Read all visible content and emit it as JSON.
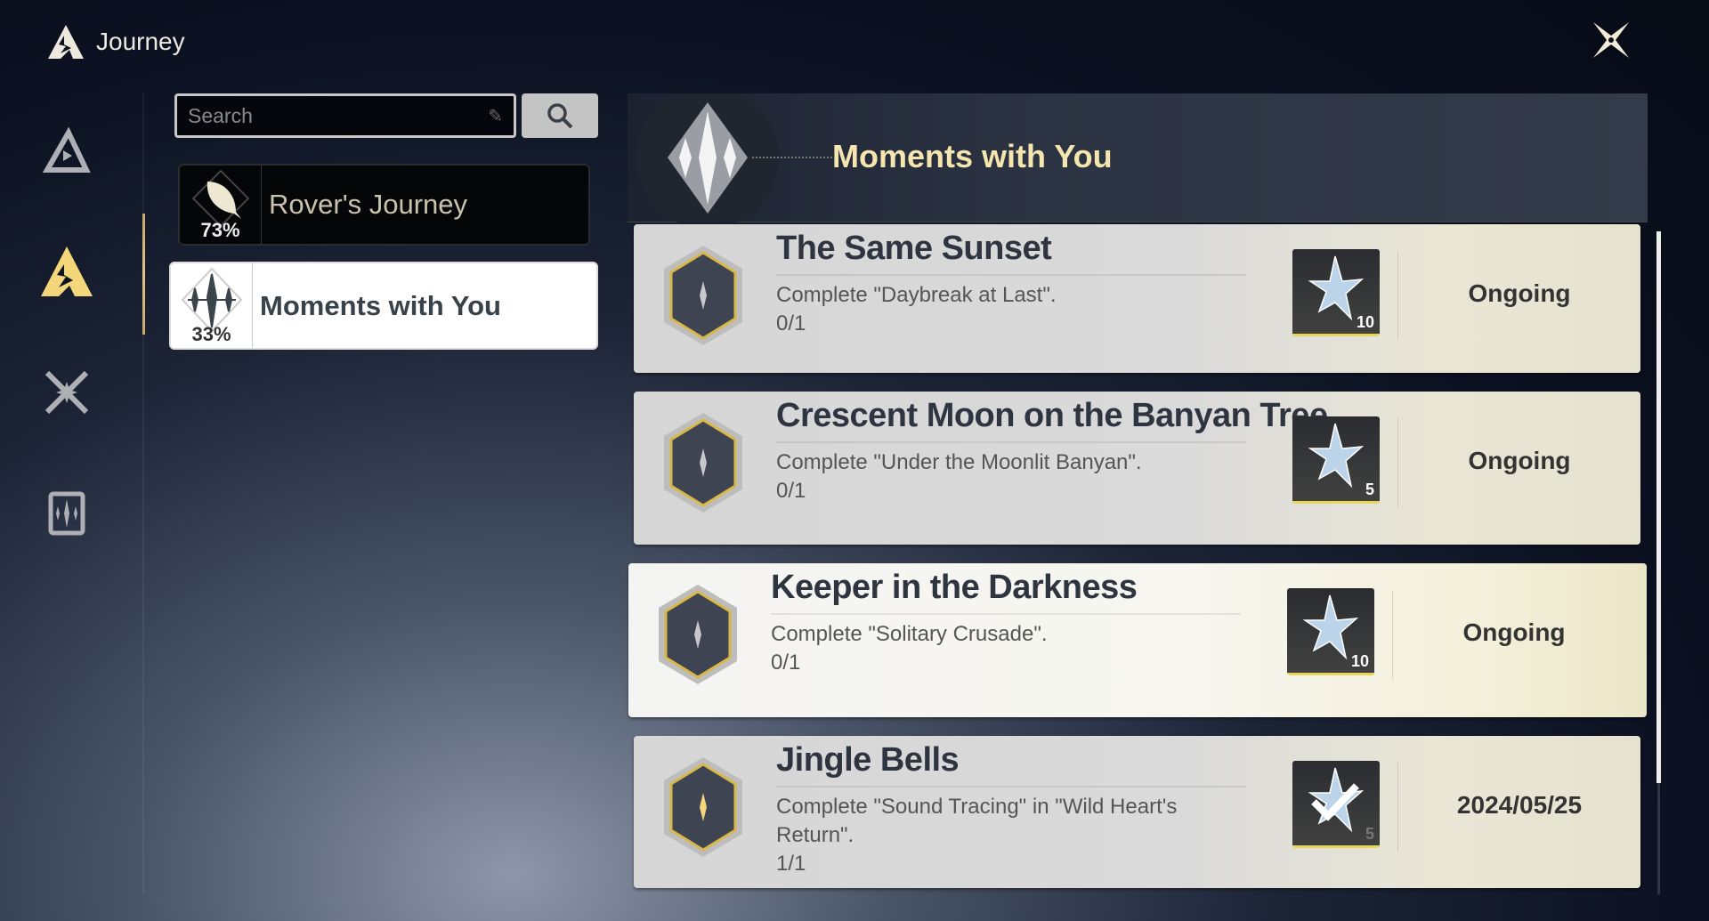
{
  "header": {
    "title": "Journey",
    "close_icon": "close-x-icon"
  },
  "nav": {
    "items": [
      {
        "icon": "triangle-play-icon"
      },
      {
        "icon": "journey-mountain-icon",
        "active": true
      },
      {
        "icon": "crossed-swords-icon"
      },
      {
        "icon": "card-sparkle-icon"
      }
    ]
  },
  "search": {
    "placeholder": "Search",
    "value": ""
  },
  "categories": [
    {
      "label": "Rover's Journey",
      "progress": "73%",
      "icon": "feather-icon"
    },
    {
      "label": "Moments with You",
      "progress": "33%",
      "icon": "sparkles-icon",
      "selected": true
    }
  ],
  "banner": {
    "title": "Moments with You"
  },
  "achievements": [
    {
      "title": "The Same Sunset",
      "desc": "Complete \"Daybreak at Last\".",
      "progress": "0/1",
      "reward": "10",
      "status": "Ongoing"
    },
    {
      "title": "Crescent Moon on the Banyan Tree",
      "desc": "Complete \"Under the Moonlit Banyan\".",
      "progress": "0/1",
      "reward": "5",
      "status": "Ongoing"
    },
    {
      "title": "Keeper in the Darkness",
      "desc": "Complete \"Solitary Crusade\".",
      "progress": "0/1",
      "reward": "10",
      "status": "Ongoing"
    },
    {
      "title": "Jingle Bells",
      "desc": "Complete \"Sound Tracing\" in \"Wild Heart's Return\".",
      "progress": "1/1",
      "reward": "5",
      "status": "2024/05/25"
    }
  ],
  "colors": {
    "accent_gold": "#f5e6b0",
    "nav_active": "#f3d77a"
  }
}
